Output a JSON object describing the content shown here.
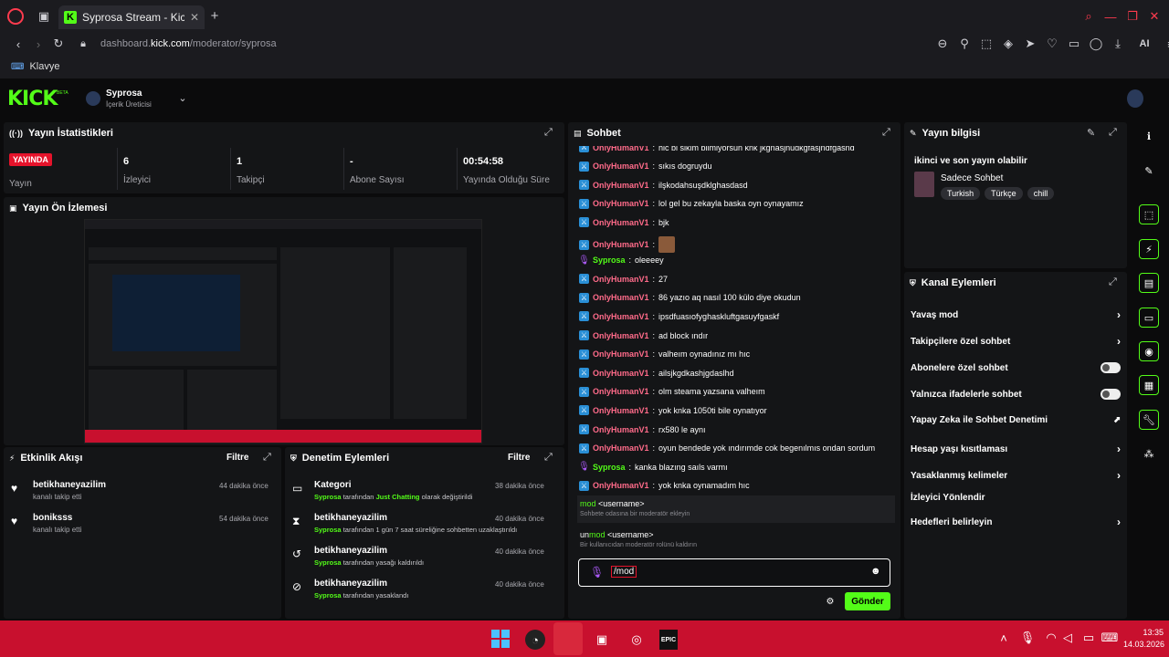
{
  "browser": {
    "tab_title": "Syprosa Stream - Kick Das",
    "url_host": "dashboard.",
    "url_domain": "kick.com",
    "url_path": "/moderator/syprosa",
    "bookmark": "Klavye",
    "ai_label": "AI"
  },
  "header": {
    "logo": "KICK",
    "beta": "BETA",
    "channel_name": "Syprosa",
    "channel_role": "İçerik Üreticisi"
  },
  "stats": {
    "title": "Yayın İstatistikleri",
    "live_badge": "YAYINDA",
    "live_label": "Yayın",
    "viewers_value": "6",
    "viewers_label": "İzleyici",
    "followers_value": "1",
    "followers_label": "Takipçi",
    "subs_value": "-",
    "subs_label": "Abone Sayısı",
    "duration_value": "00:54:58",
    "duration_label": "Yayında Olduğu Süre"
  },
  "preview": {
    "title": "Yayın Ön İzlemesi"
  },
  "activity": {
    "title": "Etkinlik Akışı",
    "filter": "Filtre",
    "items": [
      {
        "user": "betikhaneyazilim",
        "desc": "kanalı takip etti",
        "time": "44 dakika önce"
      },
      {
        "user": "boniksss",
        "desc": "kanalı takip etti",
        "time": "54 dakika önce"
      }
    ]
  },
  "modactions": {
    "title": "Denetim Eylemleri",
    "filter": "Filtre",
    "items": [
      {
        "title": "Kategori",
        "actor": "Syprosa",
        "mid": " tarafından ",
        "highlight": "Just Chatting",
        "rest": " olarak değiştirildi",
        "time": "38 dakika önce"
      },
      {
        "title": "betikhaneyazilim",
        "actor": "Syprosa",
        "mid": " tarafından 1 gün 7 saat süreliğine sohbetten uzaklaştırıldı",
        "highlight": "",
        "rest": "",
        "time": "40 dakika önce"
      },
      {
        "title": "betikhaneyazilim",
        "actor": "Syprosa",
        "mid": " tarafından yasağı kaldırıldı",
        "highlight": "",
        "rest": "",
        "time": "40 dakika önce"
      },
      {
        "title": "betikhaneyazilim",
        "actor": "Syprosa",
        "mid": " tarafından yasaklandı",
        "highlight": "",
        "rest": "",
        "time": "40 dakika önce"
      }
    ]
  },
  "chat": {
    "title": "Sohbet",
    "messages": [
      {
        "user": "OnlyHumanV1",
        "text": "hic bi sikim bilmiyorsun knk jkgnasjnudkgfasjndfgasnd",
        "badge": "mod"
      },
      {
        "user": "OnlyHumanV1",
        "text": "sıkıs dogruydu",
        "badge": "mod"
      },
      {
        "user": "OnlyHumanV1",
        "text": "ilşkodahsuşdklghasdasd",
        "badge": "mod"
      },
      {
        "user": "OnlyHumanV1",
        "text": "lol gel bu zekayla baska oyn oynayamız",
        "badge": "mod"
      },
      {
        "user": "OnlyHumanV1",
        "text": "bjk",
        "badge": "mod"
      },
      {
        "user": "OnlyHumanV1",
        "text": "",
        "badge": "mod",
        "emote": true
      },
      {
        "user": "Syprosa",
        "text": "oleeeey",
        "badge": "mic"
      },
      {
        "user": "OnlyHumanV1",
        "text": "27",
        "badge": "mod"
      },
      {
        "user": "OnlyHumanV1",
        "text": "86 yazıo aq nasıl 100 külo diye okudun",
        "badge": "mod"
      },
      {
        "user": "OnlyHumanV1",
        "text": "ipsdfuasıofyghaskluftgasuyfgaskf",
        "badge": "mod"
      },
      {
        "user": "OnlyHumanV1",
        "text": "ad block ındır",
        "badge": "mod"
      },
      {
        "user": "OnlyHumanV1",
        "text": "valheım oynadınız mı hıc",
        "badge": "mod"
      },
      {
        "user": "OnlyHumanV1",
        "text": "ailsjkgdkashjgdaslhd",
        "badge": "mod"
      },
      {
        "user": "OnlyHumanV1",
        "text": "olm steama yazsana valheım",
        "badge": "mod"
      },
      {
        "user": "OnlyHumanV1",
        "text": "yok knka 1050ti bile oynatıyor",
        "badge": "mod"
      },
      {
        "user": "OnlyHumanV1",
        "text": "rx580 le aynı",
        "badge": "mod"
      },
      {
        "user": "OnlyHumanV1",
        "text": "oyun bendede yok ındırımde cok begenılmıs ondan sordum",
        "badge": "mod"
      },
      {
        "user": "Syprosa",
        "text": "kanka blazıng saıls varmı",
        "badge": "mic"
      },
      {
        "user": "OnlyHumanV1",
        "text": "yok knka oynamadım hıc",
        "badge": "mod"
      }
    ],
    "suggestions": [
      {
        "prefix": "",
        "match": "mod",
        "suffix": " <username>",
        "desc": "Sohbete odasına bir moderatör ekleyin"
      },
      {
        "prefix": "un",
        "match": "mod",
        "suffix": " <username>",
        "desc": "Bir kullanıcıdan moderatör rolünü kaldırın"
      }
    ],
    "input_value": "/mod",
    "send_label": "Gönder"
  },
  "streaminfo": {
    "title": "Yayın bilgisi",
    "stream_title": "ikinci ve son yayın olabilir",
    "category": "Sadece Sohbet",
    "tags": [
      "Turkish",
      "Türkçe",
      "chill"
    ]
  },
  "channelactions": {
    "title": "Kanal Eylemleri",
    "items": [
      {
        "label": "Yavaş mod",
        "control": "chevron"
      },
      {
        "label": "Takipçilere özel sohbet",
        "control": "chevron"
      },
      {
        "label": "Abonelere özel sohbet",
        "control": "toggle"
      },
      {
        "label": "Yalnızca ifadelerle sohbet",
        "control": "toggle"
      },
      {
        "label": "Yapay Zeka ile Sohbet Denetimi",
        "control": "external"
      },
      {
        "label": "Hesap yaşı kısıtlaması",
        "control": "chevron"
      },
      {
        "label": "Yasaklanmış kelimeler",
        "control": "chevron"
      },
      {
        "label": "İzleyici Yönlendir",
        "control": "none"
      },
      {
        "label": "Hedefleri belirleyin",
        "control": "chevron"
      }
    ]
  },
  "taskbar": {
    "time": "13:35",
    "date": "14.03.2026"
  },
  "colors": {
    "accent": "#53fc18",
    "live": "#e5132b",
    "taskbar": "#c8102e",
    "mod_name": "#ff6b8a"
  }
}
